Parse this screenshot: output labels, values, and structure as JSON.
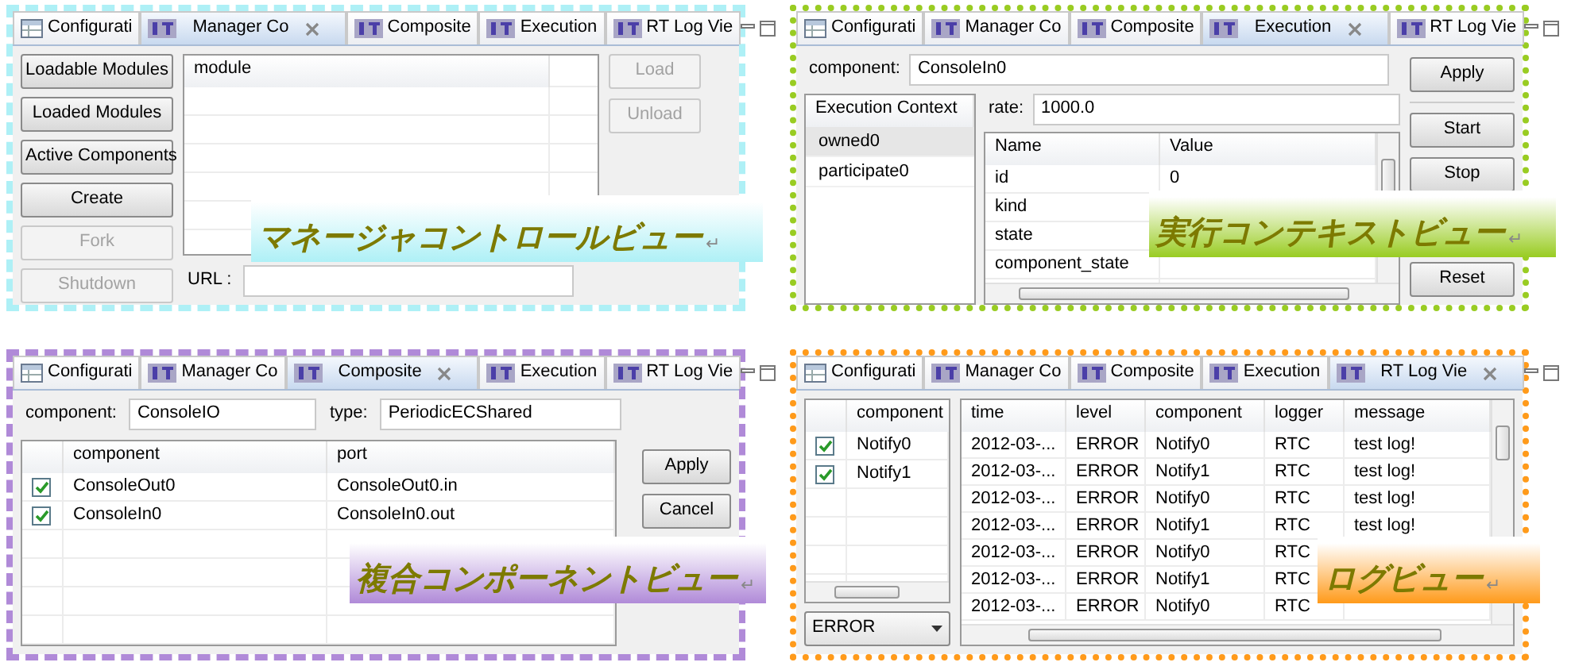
{
  "views": [
    {
      "kind": "manager",
      "color": "#aef0f6",
      "caption": "マネージャコントロールビュー",
      "caption_mark": "↵",
      "tabs": [
        {
          "label": "Configurati",
          "kind": "config",
          "selected": false
        },
        {
          "label": "Manager Co",
          "kind": "rt",
          "selected": true
        },
        {
          "label": "Composite",
          "kind": "rt",
          "selected": false
        },
        {
          "label": "Execution",
          "kind": "rt",
          "selected": false
        },
        {
          "label": "RT Log Vie",
          "kind": "rt",
          "selected": false
        }
      ],
      "side_buttons": [
        {
          "label": "Loadable Modules",
          "disabled": false
        },
        {
          "label": "Loaded Modules",
          "disabled": false
        },
        {
          "label": "Active Components",
          "disabled": false
        },
        {
          "label": "Create",
          "disabled": false
        },
        {
          "label": "Fork",
          "disabled": true
        },
        {
          "label": "Shutdown",
          "disabled": true
        }
      ],
      "table": {
        "columns": [
          "module"
        ]
      },
      "action_buttons": [
        {
          "label": "Load",
          "disabled": true
        },
        {
          "label": "Unload",
          "disabled": true
        }
      ],
      "url_label": "URL :"
    },
    {
      "kind": "execution",
      "color": "#99cc22",
      "caption": "実行コンテキストビュー",
      "caption_mark": "↵",
      "tabs": [
        {
          "label": "Configurati",
          "kind": "config",
          "selected": false
        },
        {
          "label": "Manager Co",
          "kind": "rt",
          "selected": false
        },
        {
          "label": "Composite",
          "kind": "rt",
          "selected": false
        },
        {
          "label": "Execution",
          "kind": "rt",
          "selected": true
        },
        {
          "label": "RT Log Vie",
          "kind": "rt",
          "selected": false
        }
      ],
      "component_label": "component:",
      "component": "ConsoleIn0",
      "context_header": "Execution Context",
      "contexts": [
        {
          "label": "owned0",
          "selected": true
        },
        {
          "label": "participate0",
          "selected": false
        }
      ],
      "rate_label": "rate:",
      "rate": "1000.0",
      "table": {
        "columns": [
          "Name",
          "Value"
        ],
        "rows": [
          [
            "id",
            "0"
          ],
          [
            "kind"
          ],
          [
            "state"
          ],
          [
            "component_state"
          ]
        ]
      },
      "buttons": [
        {
          "label": "Apply"
        },
        {
          "label": "Start"
        },
        {
          "label": "Stop"
        },
        {
          "label": "Reset"
        }
      ]
    },
    {
      "kind": "composite",
      "color": "#b08ad8",
      "caption": "複合コンポーネントビュー",
      "caption_mark": "↵",
      "tabs": [
        {
          "label": "Configurati",
          "kind": "config",
          "selected": false
        },
        {
          "label": "Manager Co",
          "kind": "rt",
          "selected": false
        },
        {
          "label": "Composite",
          "kind": "rt",
          "selected": true
        },
        {
          "label": "Execution",
          "kind": "rt",
          "selected": false
        },
        {
          "label": "RT Log Vie",
          "kind": "rt",
          "selected": false
        }
      ],
      "component_label": "component:",
      "component": "ConsoleIO",
      "type_label": "type:",
      "type": "PeriodicECShared",
      "table": {
        "columns": [
          "component",
          "port"
        ],
        "rows": [
          {
            "checked": true,
            "cells": [
              "ConsoleOut0",
              "ConsoleOut0.in"
            ]
          },
          {
            "checked": true,
            "cells": [
              "ConsoleIn0",
              "ConsoleIn0.out"
            ]
          }
        ]
      },
      "buttons": [
        {
          "label": "Apply"
        },
        {
          "label": "Cancel"
        }
      ]
    },
    {
      "kind": "log",
      "color": "#ff9a1a",
      "caption": "ログビュー",
      "caption_mark": "↵",
      "tabs": [
        {
          "label": "Configurati",
          "kind": "config",
          "selected": false
        },
        {
          "label": "Manager Co",
          "kind": "rt",
          "selected": false
        },
        {
          "label": "Composite",
          "kind": "rt",
          "selected": false
        },
        {
          "label": "Execution",
          "kind": "rt",
          "selected": false
        },
        {
          "label": "RT Log Vie",
          "kind": "rt",
          "selected": true
        }
      ],
      "filter": {
        "columns": [
          "component"
        ],
        "rows": [
          {
            "checked": true,
            "cells": [
              "Notify0"
            ]
          },
          {
            "checked": true,
            "cells": [
              "Notify1"
            ]
          }
        ]
      },
      "level": "ERROR",
      "table": {
        "columns": [
          "time",
          "level",
          "component",
          "logger",
          "message"
        ],
        "rows": [
          [
            "2012-03-...",
            "ERROR",
            "Notify0",
            "RTC",
            "test log!"
          ],
          [
            "2012-03-...",
            "ERROR",
            "Notify1",
            "RTC",
            "test log!"
          ],
          [
            "2012-03-...",
            "ERROR",
            "Notify0",
            "RTC",
            "test log!"
          ],
          [
            "2012-03-...",
            "ERROR",
            "Notify1",
            "RTC",
            "test log!"
          ],
          [
            "2012-03-...",
            "ERROR",
            "Notify0",
            "RTC"
          ],
          [
            "2012-03-...",
            "ERROR",
            "Notify1",
            "RTC"
          ],
          [
            "2012-03-...",
            "ERROR",
            "Notify0",
            "RTC"
          ]
        ]
      }
    }
  ]
}
